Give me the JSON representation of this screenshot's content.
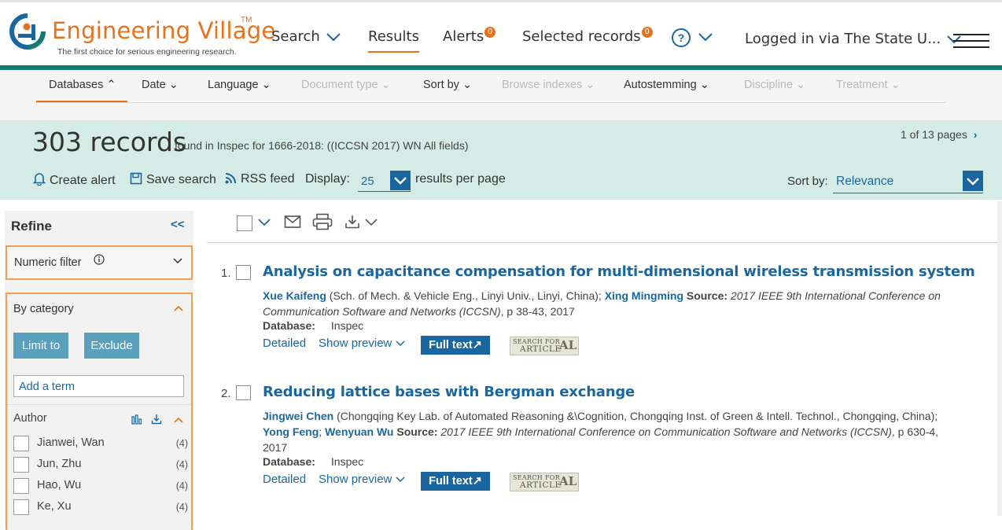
{
  "header": {
    "logo_title": "Engineering Village",
    "logo_tm": "TM",
    "tagline": "The first choice for serious engineering research.",
    "nav": {
      "search": "Search",
      "results": "Results",
      "alerts": "Alerts",
      "alerts_count": "0",
      "selected": "Selected records",
      "selected_count": "0",
      "help": "?",
      "logged_in": "Logged in via The State U..."
    }
  },
  "filters": [
    "Databases",
    "Date",
    "Language",
    "Document type",
    "Sort by",
    "Browse indexes",
    "Autostemming",
    "Discipline",
    "Treatment"
  ],
  "summary": {
    "count": "303 records",
    "found_text": "found in Inspec for 1666-2018: ((ICCSN 2017) WN All fields)",
    "pages": "1 of 13 pages",
    "create_alert": "Create alert",
    "save_search": "Save search",
    "rss_feed": "RSS feed",
    "display_label": "Display:",
    "display_value": "25",
    "results_per_page": "results per page",
    "sort_label": "Sort by:",
    "sort_value": "Relevance"
  },
  "sidebar": {
    "refine": "Refine",
    "collapse": "<<",
    "numeric_filter": "Numeric filter",
    "by_category": "By category",
    "limit_to": "Limit to",
    "exclude": "Exclude",
    "add_term_placeholder": "Add a term",
    "author_heading": "Author",
    "authors": [
      {
        "name": "Jianwei, Wan",
        "count": "(4)"
      },
      {
        "name": "Jun, Zhu",
        "count": "(4)"
      },
      {
        "name": "Hao, Wu",
        "count": "(4)"
      },
      {
        "name": "Ke, Xu",
        "count": "(4)"
      }
    ]
  },
  "results": [
    {
      "num": "1.",
      "title": "Analysis on capacitance compensation for multi-dimensional wireless transmission system",
      "author1": "Xue Kaifeng",
      "aff1": " (Sch. of Mech. & Vehicle Eng., Linyi Univ., Linyi, China); ",
      "author2": "Xing Mingming",
      "sep": "",
      "author3": "",
      "source_label": " Source: ",
      "source": "2017 IEEE 9th International Conference on Communication Software and Networks (ICCSN)",
      "pages": ", p 38-43, 2017",
      "db_label": "Database:",
      "db": "Inspec",
      "detailed": "Detailed",
      "preview": "Show preview",
      "fulltext": "Full text",
      "article_top": "SEARCH FOR",
      "article_bottom": "ARTICLE",
      "article_al": "AL"
    },
    {
      "num": "2.",
      "title": "Reducing lattice bases with Bergman exchange",
      "author1": "Jingwei Chen",
      "aff1": " (Chongqing Key Lab. of Automated Reasoning &\\Cognition, Chongqing Inst. of Green & Intell. Technol., Chongqing, China); ",
      "author2": "Yong Feng",
      "sep": "; ",
      "author3": "Wenyuan Wu",
      "source_label": " Source: ",
      "source": "2017 IEEE 9th International Conference on Communication Software and Networks (ICCSN)",
      "pages": ", p 630-4, 2017",
      "db_label": "Database:",
      "db": "Inspec",
      "detailed": "Detailed",
      "preview": "Show preview",
      "fulltext": "Full text",
      "article_top": "SEARCH FOR",
      "article_bottom": "ARTICLE",
      "article_al": "AL"
    }
  ]
}
